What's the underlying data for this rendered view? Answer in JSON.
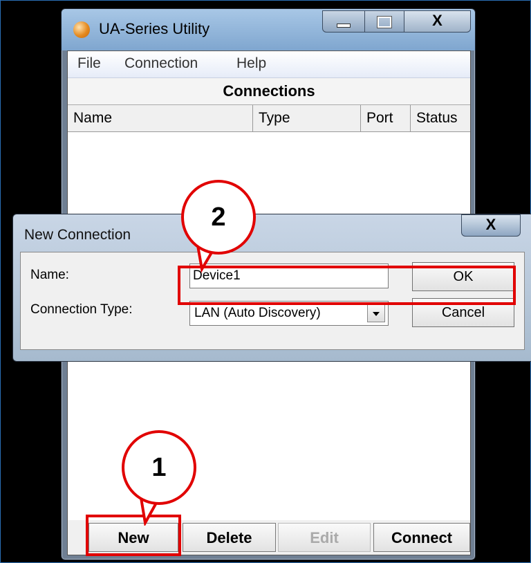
{
  "main_window": {
    "title": "UA-Series Utility",
    "close_glyph": "X",
    "menu": [
      "File",
      "Connection",
      "Help"
    ],
    "list_title": "Connections",
    "columns": [
      "Name",
      "Type",
      "Port",
      "Status"
    ],
    "buttons": {
      "new": "New",
      "delete": "Delete",
      "edit": "Edit",
      "connect": "Connect"
    }
  },
  "dialog": {
    "title": "New Connection",
    "close_glyph": "X",
    "name_label": "Name:",
    "name_value": "Device1",
    "type_label": "Connection Type:",
    "type_value": "LAN (Auto Discovery)",
    "ok_label": "OK",
    "cancel_label": "Cancel"
  },
  "annotations": {
    "step1": "1",
    "step2": "2",
    "highlight_color": "#e10000"
  },
  "colors": {
    "background": "#000000",
    "titlebar": "#a8c7e6"
  }
}
